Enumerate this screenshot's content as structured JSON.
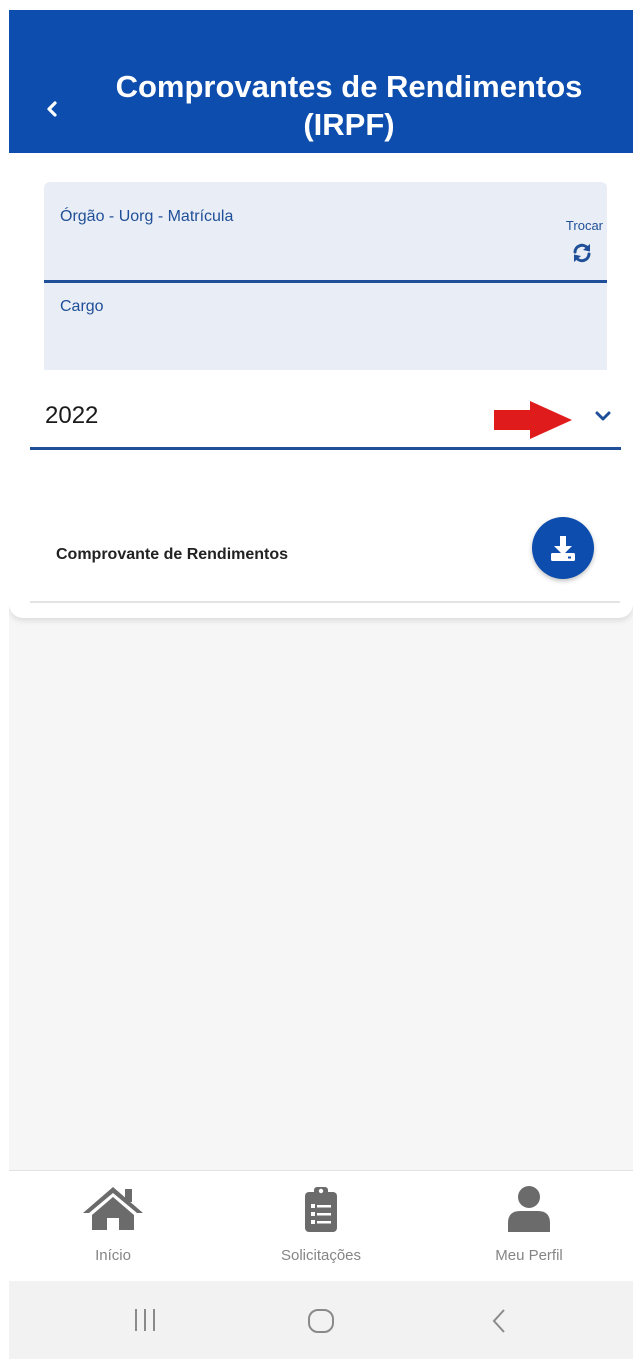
{
  "header": {
    "title": "Comprovantes de Rendimentos (IRPF)"
  },
  "info": {
    "orgao_label": "Órgão - Uorg - Matrícula",
    "swap_label": "Trocar",
    "cargo_label": "Cargo"
  },
  "year_select": {
    "selected": "2022"
  },
  "document": {
    "label": "Comprovante de Rendimentos"
  },
  "bottom_nav": {
    "items": [
      {
        "label": "Início",
        "icon": "home-icon"
      },
      {
        "label": "Solicitações",
        "icon": "clipboard-list-icon"
      },
      {
        "label": "Meu Perfil",
        "icon": "user-icon"
      }
    ]
  },
  "system_nav": {
    "icons": [
      "recent-apps-icon",
      "home-circle-icon",
      "back-chevron-icon"
    ]
  },
  "colors": {
    "primary": "#0d4dae",
    "accent_text": "#1f4f98",
    "annotation_arrow": "#e01b1b",
    "nav_icon": "#6b6b6b"
  }
}
